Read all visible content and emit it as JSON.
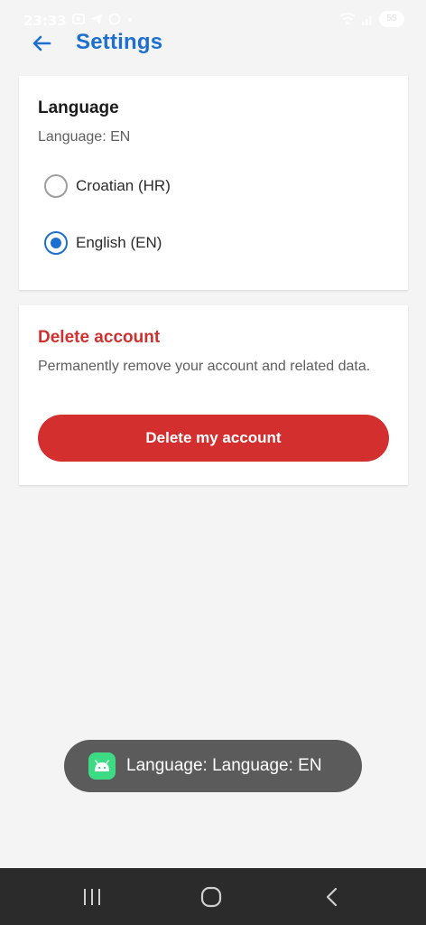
{
  "status_bar": {
    "time": "23:33",
    "battery": "55"
  },
  "header": {
    "title": "Settings"
  },
  "language_card": {
    "title": "Language",
    "subtitle": "Language: EN",
    "options": [
      {
        "label": "Croatian (HR)",
        "selected": false
      },
      {
        "label": "English (EN)",
        "selected": true
      }
    ]
  },
  "delete_card": {
    "title": "Delete account",
    "description": "Permanently remove your account and related data.",
    "button_label": "Delete my account"
  },
  "toast": {
    "message": "Language: Language: EN"
  },
  "icons": {
    "back": "arrow-left-icon",
    "toast_app": "android-icon",
    "nav_recents": "recents-icon",
    "nav_home": "home-icon",
    "nav_back": "chevron-left-icon"
  },
  "colors": {
    "accent": "#1d6fd0",
    "danger": "#d32f2f",
    "danger_text": "#cf3131",
    "background": "#f4f4f4",
    "toast_bg": "#5b5b5b",
    "nav_bar": "#2b2b2b"
  }
}
